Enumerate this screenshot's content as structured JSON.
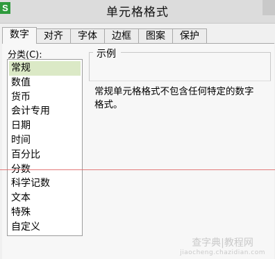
{
  "window": {
    "title": "单元格格式",
    "app_icon_letter": "S"
  },
  "tabs": [
    {
      "label": "数字",
      "active": true
    },
    {
      "label": "对齐"
    },
    {
      "label": "字体"
    },
    {
      "label": "边框"
    },
    {
      "label": "图案"
    },
    {
      "label": "保护"
    }
  ],
  "category": {
    "label": "分类(C):",
    "items": [
      "常规",
      "数值",
      "货币",
      "会计专用",
      "日期",
      "时间",
      "百分比",
      "分数",
      "科学记数",
      "文本",
      "特殊",
      "自定义"
    ],
    "selected": "常规"
  },
  "example": {
    "label": "示例"
  },
  "description": "常规单元格格式不包含任何特定的数字格式。",
  "watermark": {
    "main": "查字典|教程网",
    "sub": "jiaocheng.chazidian.com"
  },
  "colors": {
    "selected_bg": "#dbe9c6",
    "app_icon": "#2e9a3c",
    "guide_line": "#e06a6a"
  }
}
